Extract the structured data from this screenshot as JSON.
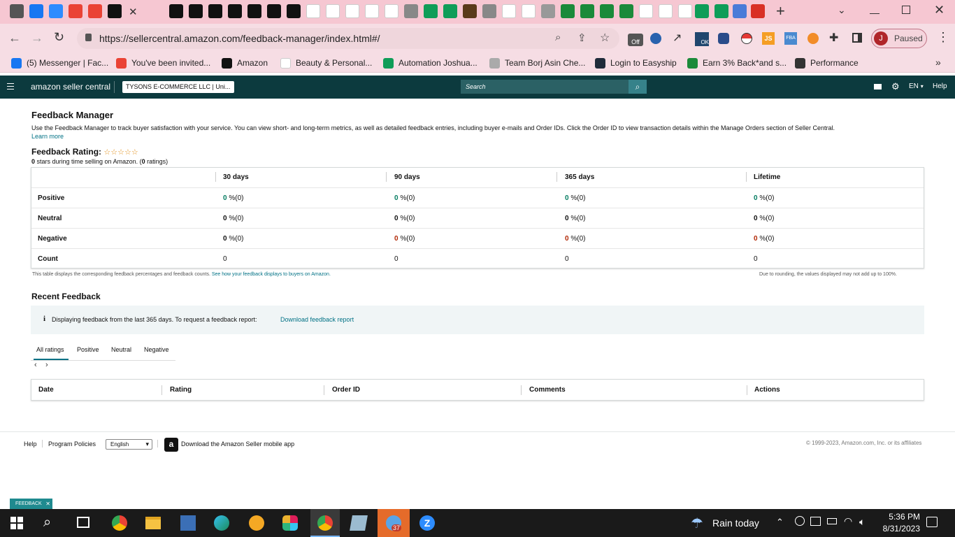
{
  "browser": {
    "url": "https://sellercentral.amazon.com/feedback-manager/index.html#/",
    "profile_initial": "J",
    "profile_status": "Paused",
    "ext_off_label": "Off",
    "ext_ok_label": "OK",
    "new_tab_glyph": "+",
    "tabs": [
      {
        "icon": "chrome-icon",
        "color": "#555"
      },
      {
        "icon": "facebook-icon",
        "color": "#1877f2"
      },
      {
        "icon": "zoom-icon",
        "color": "#2d8cff"
      },
      {
        "icon": "gmail-icon",
        "color": "#ea4335"
      },
      {
        "icon": "gmail-icon",
        "color": "#ea4335"
      },
      {
        "icon": "amazon-icon",
        "color": "#111"
      },
      {
        "icon": "amazon-icon",
        "color": "#111"
      },
      {
        "icon": "amazon-icon",
        "color": "#111"
      },
      {
        "icon": "amazon-icon",
        "color": "#111"
      },
      {
        "icon": "amazon-icon",
        "color": "#111"
      },
      {
        "icon": "amazon-icon",
        "color": "#111"
      },
      {
        "icon": "amazon-icon",
        "color": "#111"
      },
      {
        "icon": "amazon-icon",
        "color": "#111"
      },
      {
        "icon": "amazon-icon",
        "color": "#111"
      },
      {
        "icon": "amazon-smile-icon",
        "color": "#fff"
      },
      {
        "icon": "amazon-smile-icon",
        "color": "#fff"
      },
      {
        "icon": "amazon-smile-icon",
        "color": "#fff"
      },
      {
        "icon": "amazon-smile-icon",
        "color": "#fff"
      },
      {
        "icon": "amazon-smile-icon",
        "color": "#fff"
      },
      {
        "icon": "tool-icon",
        "color": "#888"
      },
      {
        "icon": "sheets-icon",
        "color": "#0f9d58"
      },
      {
        "icon": "sheets-icon",
        "color": "#0f9d58"
      },
      {
        "icon": "ups-icon",
        "color": "#5a3a1a"
      },
      {
        "icon": "globe-icon",
        "color": "#888"
      },
      {
        "icon": "google-icon",
        "color": "#fff"
      },
      {
        "icon": "google-icon",
        "color": "#fff"
      },
      {
        "icon": "plant-icon",
        "color": "#999"
      },
      {
        "icon": "vine-icon",
        "color": "#1b8a3a"
      },
      {
        "icon": "vine-icon",
        "color": "#1b8a3a"
      },
      {
        "icon": "vine-icon",
        "color": "#1b8a3a"
      },
      {
        "icon": "vine-icon",
        "color": "#1b8a3a"
      },
      {
        "icon": "google-icon",
        "color": "#fff"
      },
      {
        "icon": "amazon-smile-icon",
        "color": "#fff"
      },
      {
        "icon": "amazon-smile-icon",
        "color": "#fff"
      },
      {
        "icon": "sheets-icon",
        "color": "#0f9d58"
      },
      {
        "icon": "sheets-icon",
        "color": "#0f9d58"
      },
      {
        "icon": "pen-icon",
        "color": "#4a7bd8"
      },
      {
        "icon": "vivaldi-icon",
        "color": "#d93025"
      }
    ],
    "bookmarks": [
      {
        "icon": "facebook-icon",
        "color": "#1877f2",
        "label": "(5) Messenger | Fac..."
      },
      {
        "icon": "gmail-icon",
        "color": "#ea4335",
        "label": "You've been invited..."
      },
      {
        "icon": "amazon-icon",
        "color": "#111",
        "label": "Amazon"
      },
      {
        "icon": "amazon-smile-icon",
        "color": "#fff",
        "label": "Beauty & Personal..."
      },
      {
        "icon": "sheets-icon",
        "color": "#0f9d58",
        "label": "Automation Joshua..."
      },
      {
        "icon": "borj-icon",
        "color": "#aaa",
        "label": "Team Borj Asin Che..."
      },
      {
        "icon": "easyship-icon",
        "color": "#1f2b3a",
        "label": "Login to Easyship"
      },
      {
        "icon": "vine-icon",
        "color": "#1b8a3a",
        "label": "Earn 3% Back*and s..."
      },
      {
        "icon": "performance-icon",
        "color": "#333",
        "label": "Performance"
      }
    ]
  },
  "seller_central": {
    "logo": "amazon seller central",
    "account": "TYSONS E-COMMERCE LLC | Uni...",
    "search_placeholder": "Search",
    "language": "EN",
    "help": "Help"
  },
  "page": {
    "title": "Feedback Manager",
    "description": "Use the Feedback Manager to track buyer satisfaction with your service. You can view short- and long-term metrics, as well as detailed feedback entries, including buyer e-mails and Order IDs. Click the Order ID to view transaction details within the Manage Orders section of Seller Central.",
    "learn_more": "Learn more",
    "rating_label": "Feedback Rating:",
    "stars_glyph": "☆☆☆☆☆",
    "stars_count": "0",
    "stars_text": " stars during time selling on Amazon. (",
    "ratings_count": "0",
    "ratings_text": " ratings)"
  },
  "feedback_table": {
    "headers": [
      "30 days",
      "90 days",
      "365 days",
      "Lifetime"
    ],
    "rows": [
      {
        "label": "Positive",
        "cells": [
          {
            "v": "0",
            "p": " %(0)"
          },
          {
            "v": "0",
            "p": " %(0)"
          },
          {
            "v": "0",
            "p": " %(0)"
          },
          {
            "v": "0",
            "p": " %(0)"
          }
        ]
      },
      {
        "label": "Neutral",
        "cells": [
          {
            "v": "0",
            "p": " %(0)"
          },
          {
            "v": "0",
            "p": " %(0)"
          },
          {
            "v": "0",
            "p": " %(0)"
          },
          {
            "v": "0",
            "p": " %(0)"
          }
        ]
      },
      {
        "label": "Negative",
        "cells": [
          {
            "v": "0",
            "p": " %(0)"
          },
          {
            "v": "0",
            "p": " %(0)"
          },
          {
            "v": "0",
            "p": " %(0)"
          },
          {
            "v": "0",
            "p": " %(0)"
          }
        ]
      },
      {
        "label": "Count",
        "cells": [
          {
            "v": "0",
            "p": ""
          },
          {
            "v": "0",
            "p": ""
          },
          {
            "v": "0",
            "p": ""
          },
          {
            "v": "0",
            "p": ""
          }
        ]
      }
    ],
    "footnote": "This table displays the corresponding feedback percentages and feedback counts.",
    "footnote_link": "See how your feedback displays to buyers on Amazon.",
    "rounding_note": "Due to rounding, the values displayed may not add up to 100%."
  },
  "recent": {
    "title": "Recent Feedback",
    "info_text": "Displaying feedback from the last 365 days. To request a feedback report:",
    "download_link": "Download feedback report",
    "tabs": [
      "All ratings",
      "Positive",
      "Neutral",
      "Negative"
    ],
    "columns": [
      "Date",
      "Rating",
      "Order ID",
      "Comments",
      "Actions"
    ]
  },
  "footer": {
    "help": "Help",
    "policies": "Program Policies",
    "language": "English",
    "app_text": "Download the Amazon Seller mobile app",
    "copyright": "© 1999-2023, Amazon.com, Inc. or its affiliates",
    "feedback_tab": "FEEDBACK"
  },
  "taskbar": {
    "weather": "Rain today",
    "time": "5:36 PM",
    "date": "8/31/2023",
    "badge": "37"
  },
  "colors": {
    "tab_strip": "#f6c7d2",
    "seller_nav": "#0c3a3e",
    "positive": "#067d62",
    "negative": "#b12704",
    "link": "#007185"
  }
}
